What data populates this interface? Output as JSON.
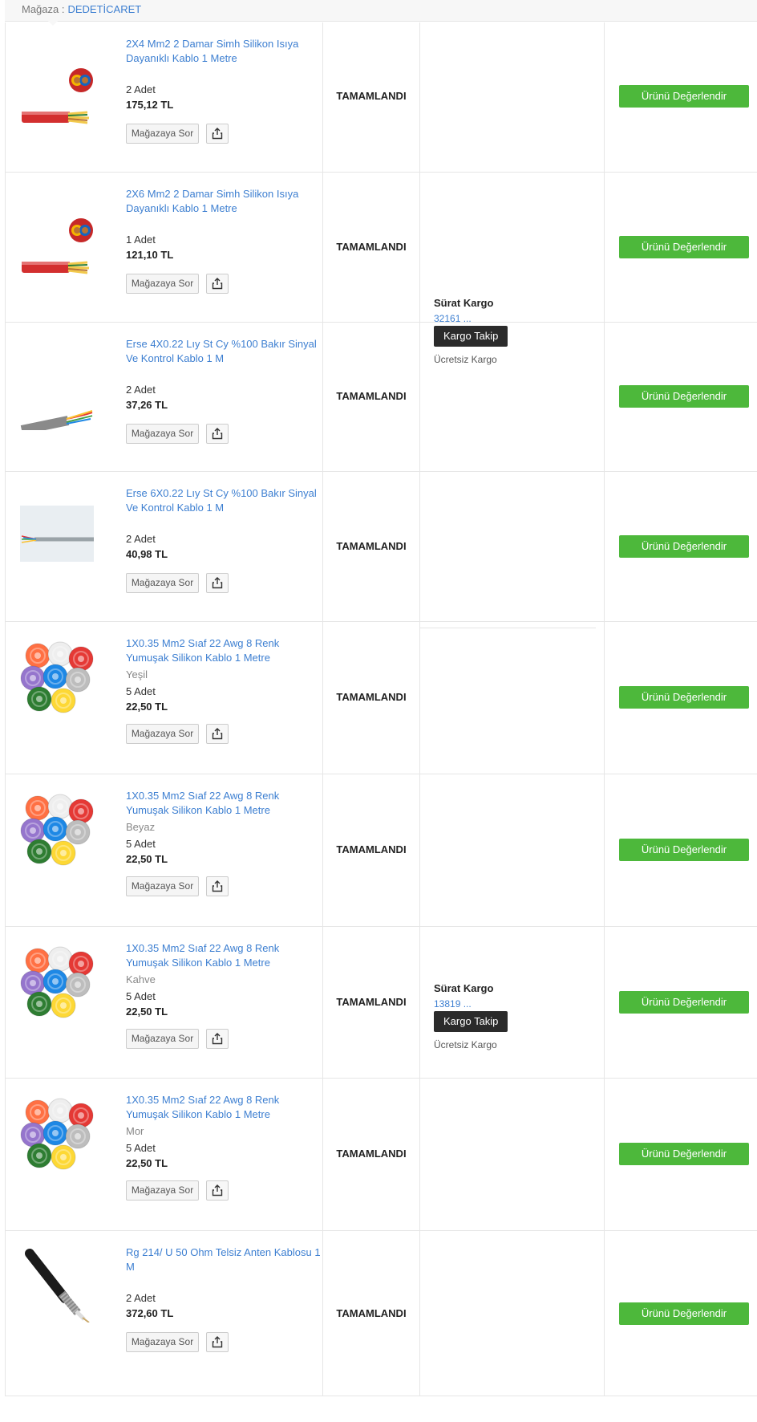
{
  "store": {
    "label": "Mağaza :",
    "name": "DEDETİCARET"
  },
  "items": [
    {
      "name": "2X4 Mm2 2 Damar Simh Silikon Isıya Dayanıklı Kablo 1 Metre",
      "variant": "",
      "qty": "2 Adet",
      "price": "175,12 TL",
      "status": "TAMAMLANDI",
      "image": "red-cable-icon"
    },
    {
      "name": "2X6 Mm2 2 Damar Simh Silikon Isıya Dayanıklı Kablo 1 Metre",
      "variant": "",
      "qty": "1 Adet",
      "price": "121,10 TL",
      "status": "TAMAMLANDI",
      "image": "red-cable-icon"
    },
    {
      "name": "Erse 4X0.22 Lıy St Cy %100 Bakır Sinyal Ve Kontrol Kablo 1 M",
      "variant": "",
      "qty": "2 Adet",
      "price": "37,26 TL",
      "status": "TAMAMLANDI",
      "image": "grey-cable-icon"
    },
    {
      "name": "Erse 6X0.22 Lıy St Cy %100 Bakır Sinyal Ve Kontrol Kablo 1 M",
      "variant": "",
      "qty": "2 Adet",
      "price": "40,98 TL",
      "status": "TAMAMLANDI",
      "image": "grey-cable-photo-icon"
    },
    {
      "name": "1X0.35 Mm2 Sıaf 22 Awg 8 Renk Yumuşak Silikon Kablo 1 Metre",
      "variant": "Yeşil",
      "qty": "5 Adet",
      "price": "22,50 TL",
      "status": "TAMAMLANDI",
      "image": "cable-spools-icon"
    },
    {
      "name": "1X0.35 Mm2 Sıaf 22 Awg 8 Renk Yumuşak Silikon Kablo 1 Metre",
      "variant": "Beyaz",
      "qty": "5 Adet",
      "price": "22,50 TL",
      "status": "TAMAMLANDI",
      "image": "cable-spools-icon"
    },
    {
      "name": "1X0.35 Mm2 Sıaf 22 Awg 8 Renk Yumuşak Silikon Kablo 1 Metre",
      "variant": "Kahve",
      "qty": "5 Adet",
      "price": "22,50 TL",
      "status": "TAMAMLANDI",
      "image": "cable-spools-icon"
    },
    {
      "name": "1X0.35 Mm2 Sıaf 22 Awg 8 Renk Yumuşak Silikon Kablo 1 Metre",
      "variant": "Mor",
      "qty": "5 Adet",
      "price": "22,50 TL",
      "status": "TAMAMLANDI",
      "image": "cable-spools-icon"
    },
    {
      "name": "Rg 214/ U 50 Ohm Telsiz Anten Kablosu 1 M",
      "variant": "",
      "qty": "2 Adet",
      "price": "372,60 TL",
      "status": "TAMAMLANDI",
      "image": "coax-cable-icon"
    }
  ],
  "buttons": {
    "ask_store": "Mağazaya Sor",
    "review": "Ürünü Değerlendir",
    "track": "Kargo Takip"
  },
  "shipments": [
    {
      "carrier": "Sürat Kargo",
      "tracking": "32161 ...",
      "free_label": "Ücretsiz Kargo"
    },
    {
      "carrier": "Sürat Kargo",
      "tracking": "13819 ...",
      "free_label": "Ücretsiz Kargo"
    }
  ],
  "colors": {
    "link": "#3d7fd1",
    "review_button": "#4db83b",
    "track_button": "#2b2b2b",
    "border": "#e6e6e6"
  }
}
